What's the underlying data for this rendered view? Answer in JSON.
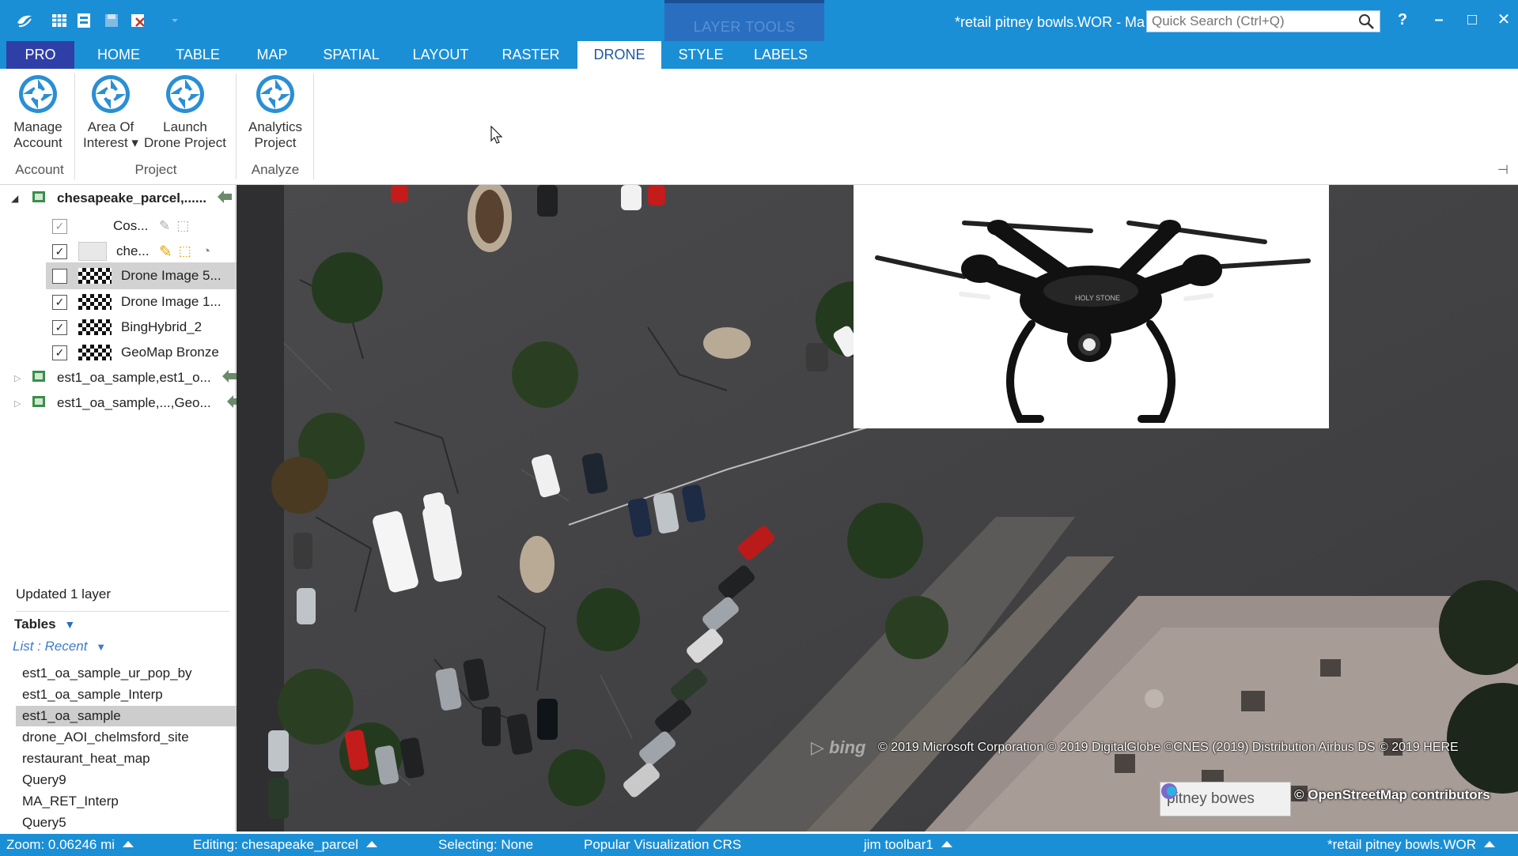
{
  "titlebar": {
    "contextual_group": "LAYER TOOLS",
    "title": "*retail pitney bowls.WOR - Ma",
    "search_placeholder": "Quick Search (Ctrl+Q)",
    "help": "?",
    "minimize": "–",
    "maximize": "□",
    "close": "✕"
  },
  "tabs": [
    "PRO",
    "HOME",
    "TABLE",
    "MAP",
    "SPATIAL",
    "LAYOUT",
    "RASTER",
    "DRONE",
    "STYLE",
    "LABELS"
  ],
  "ribbon": {
    "buttons": {
      "manage_account": [
        "Manage",
        "Account"
      ],
      "area_of_interest": [
        "Area Of",
        "Interest ▾"
      ],
      "launch_drone": [
        "Launch",
        "Drone Project"
      ],
      "analytics_project": [
        "Analytics",
        "Project"
      ]
    },
    "groups": [
      "Account",
      "Project",
      "Analyze"
    ],
    "pin": "⊣"
  },
  "layers": {
    "root": "chesapeake_parcel,......",
    "children": [
      {
        "label": "Cos...",
        "checked": true,
        "disabled": true
      },
      {
        "label": "che...",
        "checked": true,
        "disabled": false
      },
      {
        "label": "Drone Image 5...",
        "checked": false,
        "selected": true
      },
      {
        "label": "Drone Image 1...",
        "checked": true
      },
      {
        "label": "BingHybrid_2",
        "checked": true
      },
      {
        "label": "GeoMap Bronze",
        "checked": true
      }
    ],
    "others": [
      "est1_oa_sample,est1_o...",
      "est1_oa_sample,...,Geo..."
    ]
  },
  "status_message": "Updated 1 layer",
  "tables": {
    "header": "Tables",
    "list_mode": "List : Recent",
    "items": [
      "est1_oa_sample_ur_pop_by",
      "est1_oa_sample_Interp",
      "est1_oa_sample",
      "drone_AOI_chelmsford_site",
      "restaurant_heat_map",
      "Query9",
      "MA_RET_Interp",
      "Query5"
    ],
    "selected_index": 2
  },
  "map": {
    "bing": "bing",
    "copyright": "© 2019 Microsoft Corporation © 2019 DigitalGlobe ©CNES (2019) Distribution Airbus DS © 2019 HERE",
    "pb_logo": "pitney bowes",
    "osm": "© OpenStreetMap contributors",
    "drone_brand": "HOLY STONE"
  },
  "statusbar": {
    "zoom": "Zoom: 0.06246 mi",
    "editing": "Editing: chesapeake_parcel",
    "selecting": "Selecting: None",
    "crs": "Popular Visualization CRS",
    "toolbar": "jim toolbar1",
    "workspace": "*retail pitney bowls.WOR"
  },
  "colors": {
    "accent": "#1b8fd6",
    "pro_tab": "#2e3fa8",
    "status_bar": "#1b8fd6"
  }
}
